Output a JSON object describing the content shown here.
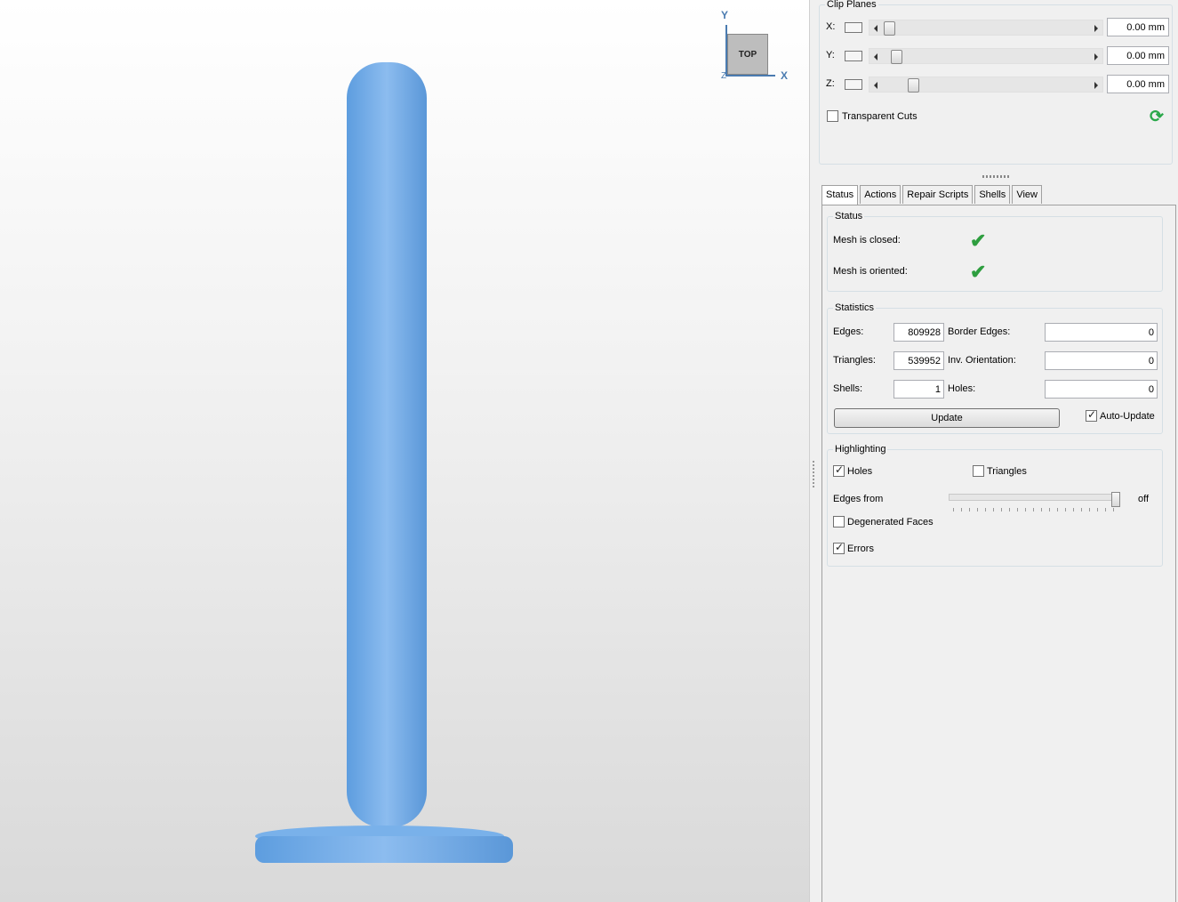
{
  "axis_widget": {
    "y_label": "Y",
    "x_label": "X",
    "z_label": "Z",
    "cube_label": "TOP"
  },
  "clip_planes": {
    "title": "Clip Planes",
    "rows": [
      {
        "axis": "X:",
        "value": "0.00 mm"
      },
      {
        "axis": "Y:",
        "value": "0.00 mm"
      },
      {
        "axis": "Z:",
        "value": "0.00 mm"
      }
    ],
    "transparent_cuts_label": "Transparent Cuts",
    "transparent_cuts_checked": false
  },
  "tabs": [
    "Status",
    "Actions",
    "Repair Scripts",
    "Shells",
    "View"
  ],
  "status": {
    "title": "Status",
    "mesh_closed_label": "Mesh is closed:",
    "mesh_oriented_label": "Mesh is oriented:"
  },
  "statistics": {
    "title": "Statistics",
    "edges_label": "Edges:",
    "edges_value": "809928",
    "triangles_label": "Triangles:",
    "triangles_value": "539952",
    "shells_label": "Shells:",
    "shells_value": "1",
    "border_edges_label": "Border Edges:",
    "border_edges_value": "0",
    "inv_orientation_label": "Inv. Orientation:",
    "inv_orientation_value": "0",
    "holes_label": "Holes:",
    "holes_value": "0",
    "update_label": "Update",
    "auto_update_label": "Auto-Update"
  },
  "highlighting": {
    "title": "Highlighting",
    "holes_label": "Holes",
    "triangles_label": "Triangles",
    "edges_from_label": "Edges from",
    "edges_from_value": "off",
    "degenerated_label": "Degenerated Faces",
    "errors_label": "Errors"
  },
  "colors": {
    "model": "#6aa6e6",
    "ok_check": "#2e9e3f",
    "axis": "#4a7bb0"
  }
}
